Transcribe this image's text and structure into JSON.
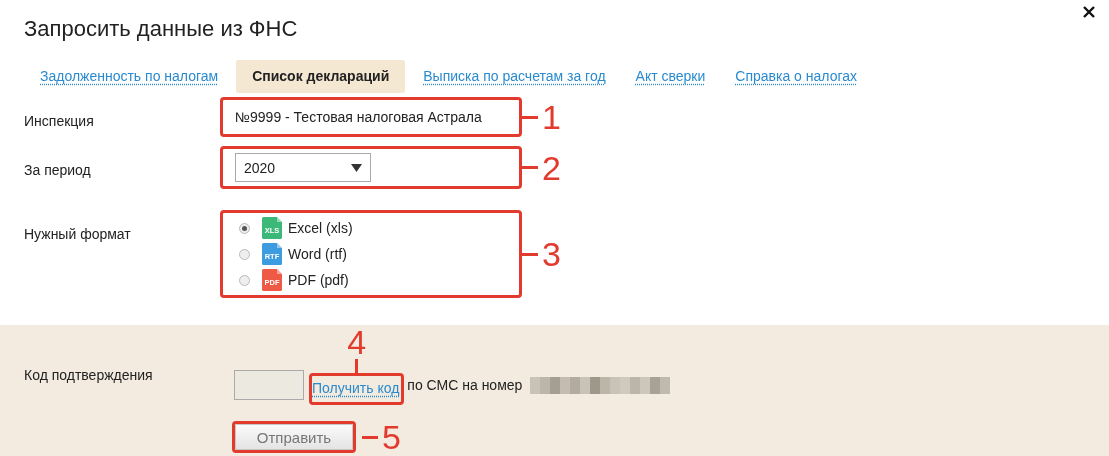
{
  "window": {
    "title": "Запросить данные из ФНС"
  },
  "tabs": [
    {
      "label": "Задолженность по налогам",
      "selected": false
    },
    {
      "label": "Список деклараций",
      "selected": true
    },
    {
      "label": "Выписка по расчетам за год",
      "selected": false
    },
    {
      "label": "Акт сверки",
      "selected": false
    },
    {
      "label": "Справка о налогах",
      "selected": false
    }
  ],
  "inspection": {
    "label": "Инспекция",
    "value": "№9999 - Тестовая налоговая Астрала",
    "callout": "1"
  },
  "period": {
    "label": "За период",
    "value": "2020",
    "callout": "2"
  },
  "format": {
    "label": "Нужный формат",
    "callout": "3",
    "options": [
      {
        "label": "Excel (xls)",
        "badge": "XLS",
        "color": "#3cb878",
        "selected": true
      },
      {
        "label": "Word (rtf)",
        "badge": "RTF",
        "color": "#3d9be0",
        "selected": false
      },
      {
        "label": "PDF (pdf)",
        "badge": "PDF",
        "color": "#ee5a45",
        "selected": false
      }
    ]
  },
  "confirmation": {
    "label": "Код подтверждения",
    "link": "Получить код",
    "link_callout": "4",
    "text": "по СМС на номер",
    "button": "Отправить",
    "button_callout": "5"
  }
}
